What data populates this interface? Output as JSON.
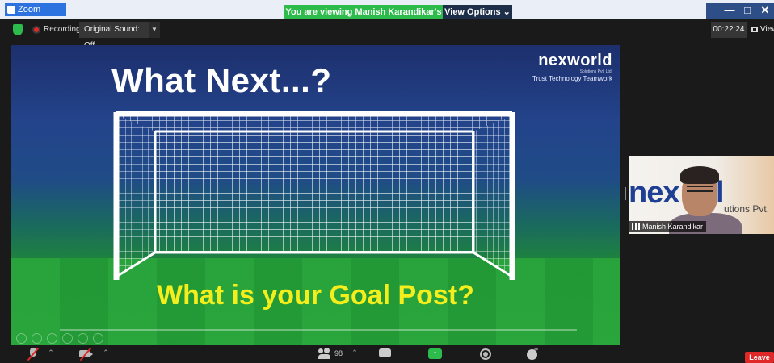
{
  "window": {
    "title": "Zoom Meeting",
    "controls": [
      "—",
      "□",
      "✕"
    ]
  },
  "banner": {
    "text": "You are viewing Manish Karandikar's screen",
    "color": "#2dbb4b"
  },
  "view_options": {
    "label": "View Options ⌄"
  },
  "topbar": {
    "shield_icon": "security-shield-icon",
    "recording_label": "Recording",
    "original_sound": "Original Sound: Off",
    "timer": "00:22:24",
    "view_label": "View"
  },
  "slide": {
    "title": "What Next...?",
    "question": "What is your Goal Post?",
    "logo": {
      "name": "nexworld",
      "sub": "Solutions Pvt. Ltd.",
      "tagline": "Trust Technology Teamwork"
    }
  },
  "participant_video": {
    "name": "Manish Karandikar",
    "background_brand_a": "nex",
    "background_brand_b": "orl",
    "background_sub": "utions Pvt."
  },
  "toolbar": {
    "participants_count": "98",
    "share_glyph": "↑",
    "leave_label": "Leave",
    "leave_color": "#e02828"
  }
}
